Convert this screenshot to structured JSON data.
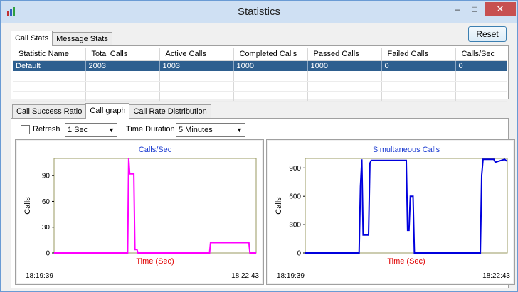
{
  "window": {
    "title": "Statistics"
  },
  "titlebar": {
    "minimize": "‒",
    "maximize": "□",
    "close": "✕"
  },
  "top_tabs": [
    "Call Stats",
    "Message Stats"
  ],
  "reset_label": "Reset",
  "stats_table": {
    "headers": [
      "Statistic Name",
      "Total Calls",
      "Active Calls",
      "Completed Calls",
      "Passed Calls",
      "Failed Calls",
      "Calls/Sec"
    ],
    "rows": [
      [
        "Default",
        "2003",
        "1003",
        "1000",
        "1000",
        "0",
        "0"
      ]
    ]
  },
  "graph_tabs": [
    "Call Success Ratio",
    "Call graph",
    "Call Rate Distribution"
  ],
  "controls": {
    "refresh_label": "Refresh",
    "refresh_checked": false,
    "refresh_interval": "1 Sec",
    "duration_label": "Time Duration",
    "duration_value": "5 Minutes"
  },
  "chart_data": [
    {
      "type": "line",
      "title": "Calls/Sec",
      "xlabel": "Time (Sec)",
      "ylabel": "Calls",
      "ylim": [
        0,
        110
      ],
      "yticks": [
        "0",
        "30",
        "60",
        "90"
      ],
      "x_start_label": "18:19:39",
      "x_end_label": "18:22:43",
      "color": "#ff00ff",
      "series": [
        {
          "x": [
            0,
            71,
            72,
            73,
            74,
            77,
            78,
            80,
            81,
            150,
            151,
            188,
            189,
            195
          ],
          "y": [
            0,
            0,
            110,
            92,
            92,
            92,
            4,
            4,
            0,
            0,
            12,
            12,
            0,
            0
          ]
        }
      ]
    },
    {
      "type": "line",
      "title": "Simultaneous Calls",
      "xlabel": "Time (Sec)",
      "ylabel": "Calls",
      "ylim": [
        0,
        1000
      ],
      "yticks": [
        "0",
        "300",
        "600",
        "900"
      ],
      "x_start_label": "18:19:39",
      "x_end_label": "18:22:43",
      "color": "#0000dd",
      "series": [
        {
          "x": [
            0,
            40,
            41,
            42,
            43,
            47,
            48,
            49,
            75,
            76,
            77,
            78,
            80,
            81,
            130,
            131,
            132,
            140,
            141,
            148,
            149,
            150
          ],
          "y": [
            0,
            0,
            700,
            990,
            190,
            190,
            950,
            980,
            980,
            240,
            240,
            600,
            600,
            0,
            0,
            820,
            990,
            990,
            960,
            990,
            980,
            970
          ]
        }
      ]
    }
  ]
}
